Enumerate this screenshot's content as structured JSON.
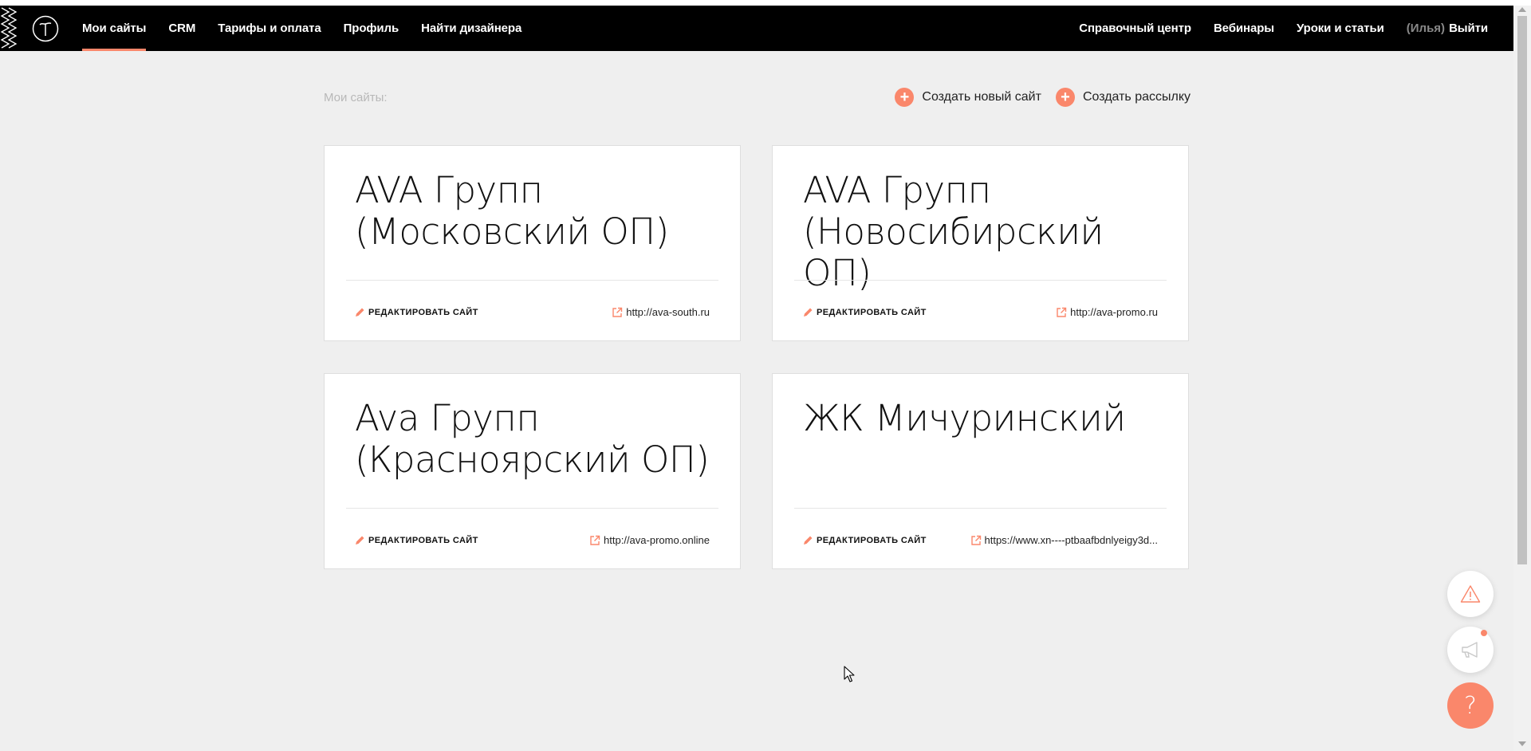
{
  "nav": {
    "left_items": [
      {
        "label": "Мои сайты",
        "active": true
      },
      {
        "label": "CRM",
        "active": false
      },
      {
        "label": "Тарифы и оплата",
        "active": false
      },
      {
        "label": "Профиль",
        "active": false
      },
      {
        "label": "Найти дизайнера",
        "active": false
      }
    ],
    "right_items": [
      {
        "label": "Справочный центр"
      },
      {
        "label": "Вебинары"
      },
      {
        "label": "Уроки и статьи"
      }
    ],
    "user_name": "(Илья)",
    "logout_label": "Выйти"
  },
  "page": {
    "section_label": "Мои сайты:",
    "actions": [
      {
        "label": "Создать новый сайт",
        "icon": "plus-icon"
      },
      {
        "label": "Создать рассылку",
        "icon": "plus-icon"
      }
    ]
  },
  "sites": [
    {
      "title_line1": "AVA Групп",
      "title_line2": "(Московский ОП)",
      "edit_label": "РЕДАКТИРОВАТЬ САЙТ",
      "url": "http://ava-south.ru"
    },
    {
      "title_line1": "AVA Групп",
      "title_line2": "(Новосибирский ОП)",
      "edit_label": "РЕДАКТИРОВАТЬ САЙТ",
      "url": "http://ava-promo.ru"
    },
    {
      "title_line1": "Ava Групп",
      "title_line2": "(Красноярский ОП)",
      "edit_label": "РЕДАКТИРОВАТЬ САЙТ",
      "url": "http://ava-promo.online"
    },
    {
      "title_line1": "ЖК Мичуринский",
      "title_line2": "",
      "edit_label": "РЕДАКТИРОВАТЬ САЙТ",
      "url": "https://www.xn----ptbaafbdnlyeigy3d..."
    }
  ],
  "floating": {
    "help_glyph": "?"
  },
  "colors": {
    "accent": "#fa876b",
    "navbar_bg": "#000000",
    "page_bg": "#efefef"
  }
}
